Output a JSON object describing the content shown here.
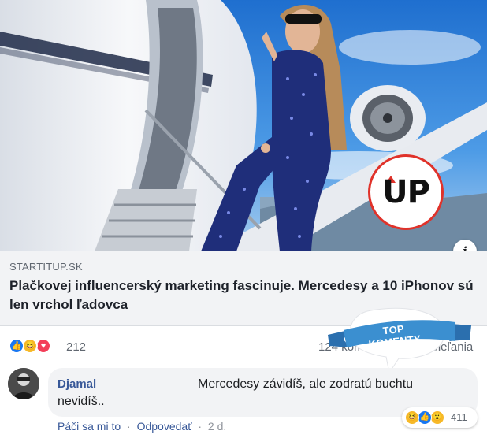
{
  "hero": {
    "logo_text": "UP",
    "info_label": "i",
    "colors": {
      "sky": "#2a7fd6",
      "jet": "#f1f3f6",
      "suit": "#1f2e7a",
      "logo_ring": "#e0322a"
    }
  },
  "link": {
    "domain": "STARTITUP.SK",
    "title": "Plačkovej influencerský marketing fascinuje. Mercedesy a 10 iPhonov sú len vrchol ľadovca"
  },
  "reactions": {
    "icons": [
      "like-icon",
      "haha-icon",
      "love-icon"
    ],
    "count": "212",
    "comments_text": "124 kom",
    "shares_text": "zdieľania"
  },
  "badge": {
    "label": "TOP KOMENTY",
    "color": "#3b8fd0"
  },
  "comment": {
    "author": "Djamal",
    "text_line1": "Mercedesy závidíš, ale zodratú buchtu",
    "text_line2": "nevidíš..",
    "reaction_icons": [
      "haha-icon",
      "like-icon",
      "wow-icon"
    ],
    "reaction_count": "411",
    "actions": {
      "like": "Páči sa mi to",
      "reply": "Odpovedať",
      "time": "2 d."
    },
    "separator": "·"
  }
}
